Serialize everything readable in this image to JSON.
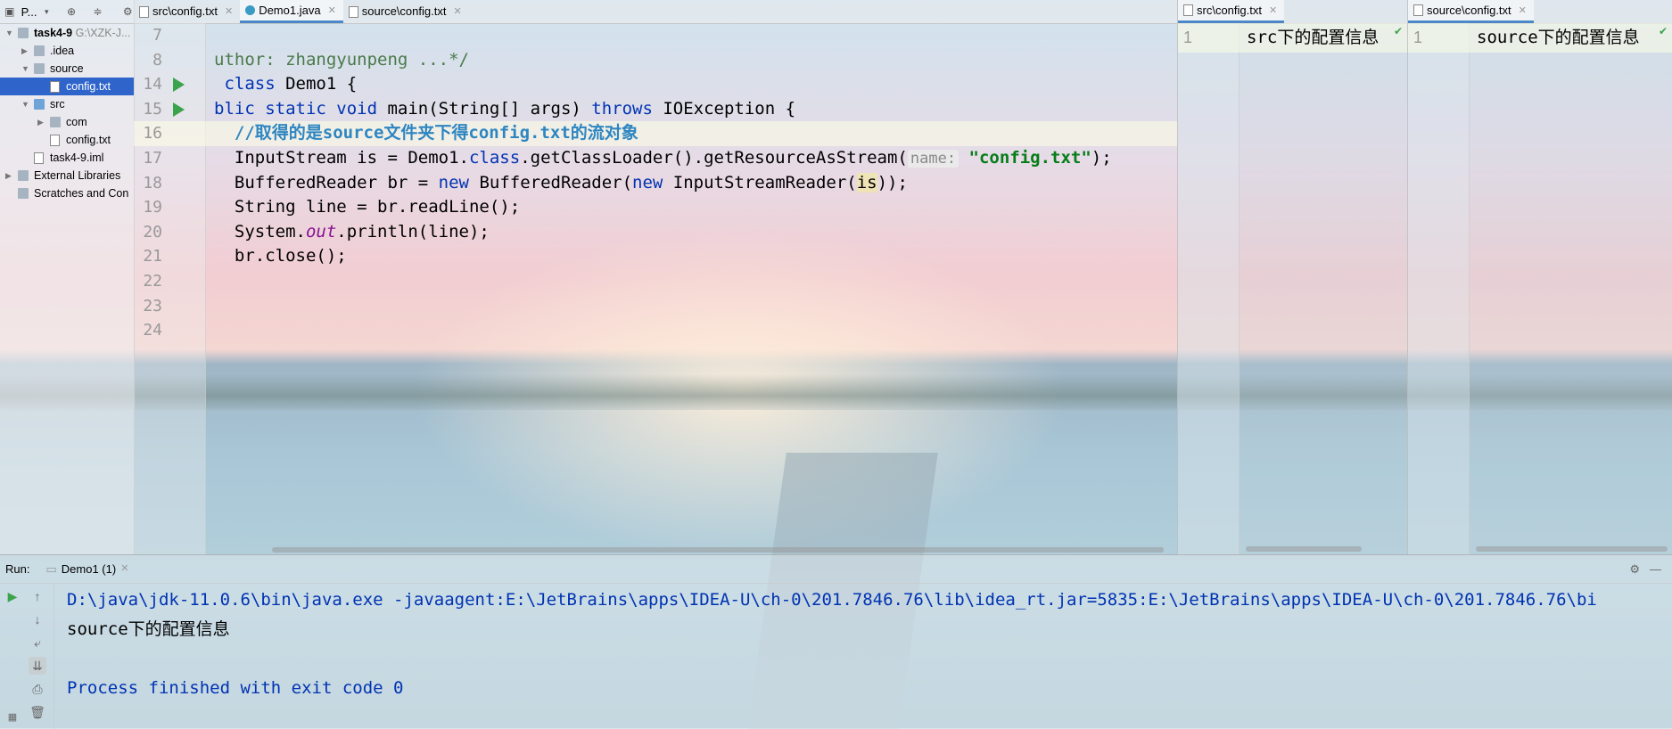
{
  "project": {
    "title": "P...",
    "tree": [
      {
        "label": "task4-9",
        "suffix": "G:\\XZK-J...",
        "depth": 0,
        "type": "module",
        "expanded": true
      },
      {
        "label": ".idea",
        "depth": 1,
        "type": "folder",
        "expanded": false
      },
      {
        "label": "source",
        "depth": 1,
        "type": "folder",
        "expanded": true
      },
      {
        "label": "config.txt",
        "depth": 2,
        "type": "file",
        "selected": true
      },
      {
        "label": "src",
        "depth": 1,
        "type": "folder-blue",
        "expanded": true
      },
      {
        "label": "com",
        "depth": 2,
        "type": "folder",
        "expanded": false
      },
      {
        "label": "config.txt",
        "depth": 2,
        "type": "file"
      },
      {
        "label": "task4-9.iml",
        "depth": 1,
        "type": "file"
      },
      {
        "label": "External Libraries",
        "depth": 0,
        "type": "library",
        "expanded": false
      },
      {
        "label": "Scratches and Con",
        "depth": 0,
        "type": "scratch"
      }
    ]
  },
  "editor": {
    "tabs": [
      {
        "label": "src\\config.txt",
        "icon": "text-file-icon",
        "active": false
      },
      {
        "label": "Demo1.java",
        "icon": "java-class-icon",
        "active": true
      },
      {
        "label": "source\\config.txt",
        "icon": "text-file-icon",
        "active": false
      }
    ],
    "lines": [
      {
        "num": "7",
        "parts": []
      },
      {
        "num": "8",
        "parts": [
          {
            "t": "uthor: zhangyunpeng ...*/",
            "c": "cmg"
          }
        ]
      },
      {
        "num": "14",
        "run": true,
        "parts": [
          {
            "t": " ",
            "c": ""
          },
          {
            "t": "class",
            "c": "kw"
          },
          {
            "t": " Demo1 {",
            "c": ""
          }
        ]
      },
      {
        "num": "15",
        "run": true,
        "parts": [
          {
            "t": "blic ",
            "c": "kw"
          },
          {
            "t": "static void",
            "c": "kw"
          },
          {
            "t": " main(String[] args) ",
            "c": ""
          },
          {
            "t": "throws",
            "c": "kw"
          },
          {
            "t": " IOException {",
            "c": ""
          }
        ]
      },
      {
        "num": "16",
        "current": true,
        "parts": [
          {
            "t": "  ",
            "c": ""
          },
          {
            "t": "//取得的是source文件夹下得config.txt的流对象",
            "c": "cm"
          }
        ]
      },
      {
        "num": "17",
        "parts": [
          {
            "t": "  InputStream is = Demo1.",
            "c": ""
          },
          {
            "t": "class",
            "c": "kw"
          },
          {
            "t": ".getClassLoader().getResourceAsStream(",
            "c": ""
          },
          {
            "t": "name:",
            "c": "hint"
          },
          {
            "t": " ",
            "c": ""
          },
          {
            "t": "\"config.txt\"",
            "c": "str"
          },
          {
            "t": ");",
            "c": ""
          }
        ]
      },
      {
        "num": "18",
        "parts": [
          {
            "t": "  BufferedReader br = ",
            "c": ""
          },
          {
            "t": "new",
            "c": "kw"
          },
          {
            "t": " BufferedReader(",
            "c": ""
          },
          {
            "t": "new",
            "c": "kw"
          },
          {
            "t": " InputStreamReader(",
            "c": ""
          },
          {
            "t": "is",
            "c": "hl"
          },
          {
            "t": "));",
            "c": ""
          }
        ]
      },
      {
        "num": "19",
        "parts": [
          {
            "t": "  String line = br.readLine();",
            "c": ""
          }
        ]
      },
      {
        "num": "20",
        "parts": [
          {
            "t": "  System.",
            "c": ""
          },
          {
            "t": "out",
            "c": "fld"
          },
          {
            "t": ".println(line);",
            "c": ""
          }
        ]
      },
      {
        "num": "21",
        "parts": [
          {
            "t": "  br.close();",
            "c": ""
          }
        ]
      },
      {
        "num": "22",
        "parts": []
      },
      {
        "num": "23",
        "parts": []
      },
      {
        "num": "24",
        "parts": []
      }
    ]
  },
  "split_left": {
    "tab": "src\\config.txt",
    "line_num": "1",
    "content": "src下的配置信息"
  },
  "split_right": {
    "tab": "source\\config.txt",
    "line_num": "1",
    "content": "source下的配置信息"
  },
  "run": {
    "label": "Run:",
    "tab": "Demo1 (1)",
    "output": [
      {
        "t": "D:\\java\\jdk-11.0.6\\bin\\java.exe -javaagent:E:\\JetBrains\\apps\\IDEA-U\\ch-0\\201.7846.76\\lib\\idea_rt.jar=5835:E:\\JetBrains\\apps\\IDEA-U\\ch-0\\201.7846.76\\bi",
        "c": "cmd"
      },
      {
        "t": "source下的配置信息",
        "c": ""
      },
      {
        "t": "",
        "c": ""
      },
      {
        "t": "Process finished with exit code 0",
        "c": "exit"
      }
    ]
  },
  "colors": {
    "accent": "#2f65ca",
    "run_green": "#3aa34b",
    "keyword": "#0033b3",
    "string": "#067d17"
  }
}
